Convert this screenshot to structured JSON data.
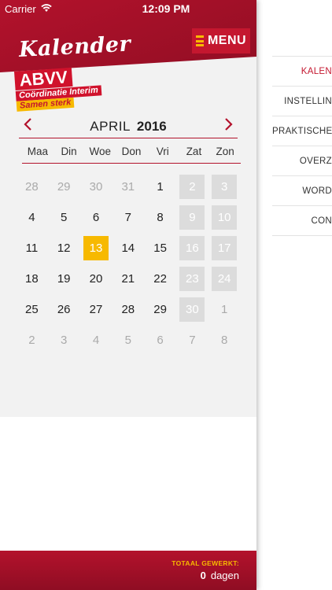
{
  "status_bar": {
    "carrier": "Carrier",
    "time": "12:09 PM"
  },
  "header": {
    "title": "Kalender",
    "menu_label": "MENU"
  },
  "logo": {
    "name": "ABVV",
    "line1": "Coördinatie Interim",
    "line2": "Samen sterk"
  },
  "calendar": {
    "month": "APRIL",
    "year": "2016",
    "weekdays": [
      "Maa",
      "Din",
      "Woe",
      "Don",
      "Vri",
      "Zat",
      "Zon"
    ],
    "weeks": [
      [
        "28",
        "29",
        "30",
        "31",
        "1",
        "2",
        "3"
      ],
      [
        "4",
        "5",
        "6",
        "7",
        "8",
        "9",
        "10"
      ],
      [
        "11",
        "12",
        "13",
        "14",
        "15",
        "16",
        "17"
      ],
      [
        "18",
        "19",
        "20",
        "21",
        "22",
        "23",
        "24"
      ],
      [
        "25",
        "26",
        "27",
        "28",
        "29",
        "30",
        "1"
      ],
      [
        "2",
        "3",
        "4",
        "5",
        "6",
        "7",
        "8"
      ]
    ],
    "today": "13"
  },
  "footer": {
    "label": "TOTAAL GEWERKT:",
    "count": "0",
    "unit": "dagen"
  },
  "side_menu": {
    "items": [
      "KALEN",
      "INSTELLIN",
      "PRAKTISCHE",
      "OVERZ",
      "WORD",
      "CON"
    ],
    "active_index": 0
  },
  "colors": {
    "brand_red": "#b3122c",
    "accent_yellow": "#f7b900",
    "weekend_grey": "#dcdcdc"
  }
}
